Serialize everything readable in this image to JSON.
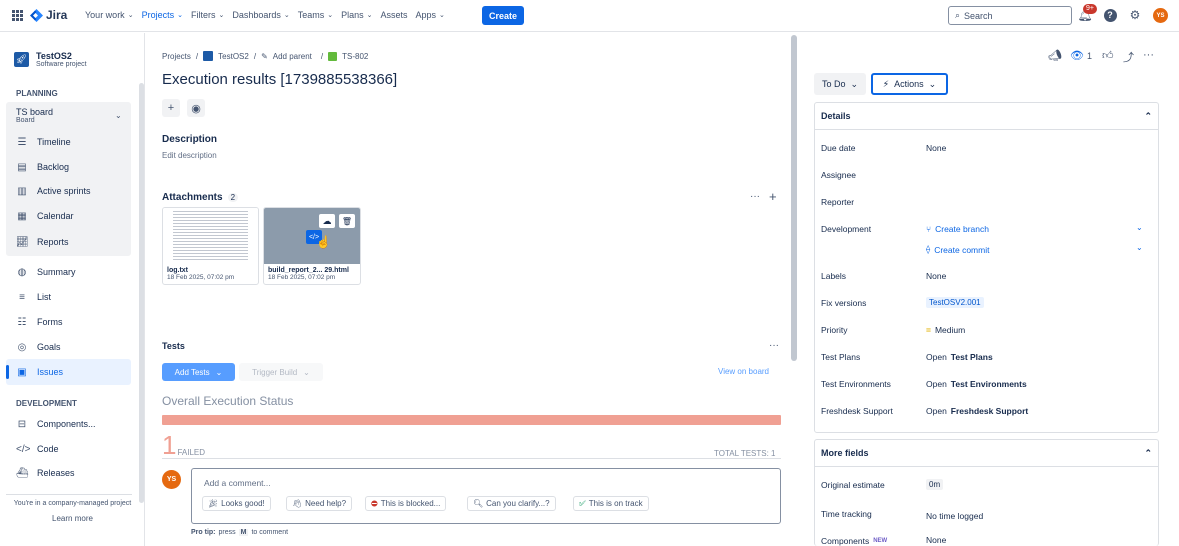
{
  "topnav": {
    "app_name": "Jira",
    "items": [
      {
        "label": "Your work",
        "active": false
      },
      {
        "label": "Projects",
        "active": true
      },
      {
        "label": "Filters",
        "active": false
      },
      {
        "label": "Dashboards",
        "active": false
      },
      {
        "label": "Teams",
        "active": false
      },
      {
        "label": "Plans",
        "active": false
      },
      {
        "label": "Assets",
        "active": false
      },
      {
        "label": "Apps",
        "active": false
      }
    ],
    "create_label": "Create",
    "search_placeholder": "Search",
    "notification_badge": "9+",
    "avatar_initials": "YS"
  },
  "sidebar": {
    "project_name": "TestOS2",
    "project_type": "Software project",
    "planning_heading": "PLANNING",
    "board_name": "TS board",
    "board_sub": "Board",
    "planning_items": [
      "Timeline",
      "Backlog",
      "Active sprints",
      "Calendar",
      "Reports"
    ],
    "items": [
      "Summary",
      "List",
      "Forms",
      "Goals",
      "Issues"
    ],
    "development_heading": "DEVELOPMENT",
    "dev_items": [
      "Components...",
      "Code",
      "Releases"
    ],
    "footer_text": "You're in a company-managed project",
    "learn_more": "Learn more"
  },
  "main": {
    "breadcrumb": [
      "Projects",
      "TestOS2",
      "Add parent",
      "TS-802"
    ],
    "title": "Execution results [1739885538366]",
    "description_heading": "Description",
    "description_placeholder": "Edit description",
    "attachments_heading": "Attachments",
    "attachments_count": "2",
    "attachments": [
      {
        "name": "log.txt",
        "date": "18 Feb 2025, 07:02 pm"
      },
      {
        "name": "build_report_2... 29.html",
        "date": "18 Feb 2025, 07:02 pm"
      }
    ],
    "tests_heading": "Tests",
    "add_tests_label": "Add Tests",
    "trigger_build_label": "Trigger Build",
    "view_on_board": "View on board",
    "overall_status": "Overall Execution Status",
    "failed_count": "1",
    "failed_label": "FAILED",
    "total_tests": "TOTAL TESTS: 1",
    "failed_fraction": 1.0,
    "comment_avatar": "YS",
    "comment_placeholder": "Add a comment...",
    "chips": [
      "Looks good!",
      "Need help?",
      "This is blocked...",
      "Can you clarify...?",
      "This is on track"
    ],
    "pro_tip": "Pro tip:",
    "pro_tip_text_a": "press",
    "pro_tip_key": "M",
    "pro_tip_text_b": "to comment"
  },
  "right": {
    "watch_count": "1",
    "status_label": "To Do",
    "actions_label": "Actions",
    "details_heading": "Details",
    "fields": {
      "due_date_label": "Due date",
      "due_date_value": "None",
      "assignee_label": "Assignee",
      "reporter_label": "Reporter",
      "development_label": "Development",
      "create_branch": "Create branch",
      "create_commit": "Create commit",
      "labels_label": "Labels",
      "labels_value": "None",
      "fix_versions_label": "Fix versions",
      "fix_versions_value": "TestOSV2.001",
      "priority_label": "Priority",
      "priority_value": "Medium",
      "test_plans_label": "Test Plans",
      "test_plans_open": "Open",
      "test_plans_value": "Test Plans",
      "test_env_label": "Test Environments",
      "test_env_open": "Open",
      "test_env_value": "Test Environments",
      "freshdesk_label": "Freshdesk Support",
      "freshdesk_open": "Open",
      "freshdesk_value": "Freshdesk Support"
    },
    "more_fields_heading": "More fields",
    "original_estimate_label": "Original estimate",
    "original_estimate_value": "0m",
    "time_tracking_label": "Time tracking",
    "time_tracking_value": "No time logged",
    "components_label": "Components",
    "components_badge": "NEW",
    "components_value": "None"
  }
}
